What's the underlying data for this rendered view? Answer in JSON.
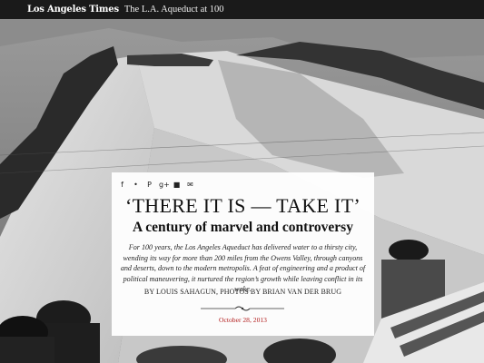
{
  "topbar": {
    "logo": "Los Angeles Times",
    "section": "The L.A. Aqueduct at 100"
  },
  "share_icons": [
    {
      "icon": "facebook-icon",
      "glyph": "f"
    },
    {
      "icon": "twitter-icon",
      "glyph": "•"
    },
    {
      "icon": "pinterest-icon",
      "glyph": "P"
    },
    {
      "icon": "googleplus-icon",
      "glyph": "g+"
    },
    {
      "icon": "comment-icon",
      "glyph": "■"
    },
    {
      "icon": "email-icon",
      "glyph": "✉"
    }
  ],
  "article": {
    "headline": "‘THERE IT IS — TAKE IT’",
    "dek": "A century of marvel and controversy",
    "summary": "For 100 years, the Los Angeles Aqueduct has delivered water to a thirsty city, wending its way for more than 200 miles from the Owens Valley, through canyons and deserts, down to the modern metropolis. A feat of engineering and a product of political maneuvering, it nurtured the region’s growth while leaving conflict in its wake.",
    "byline": "BY LOUIS SAHAGUN, PHOTOS BY BRIAN VAN DER BRUG",
    "date": "October 28, 2013"
  },
  "colors": {
    "topbar": "#1a1a1a",
    "date_red": "#b21c1c"
  }
}
